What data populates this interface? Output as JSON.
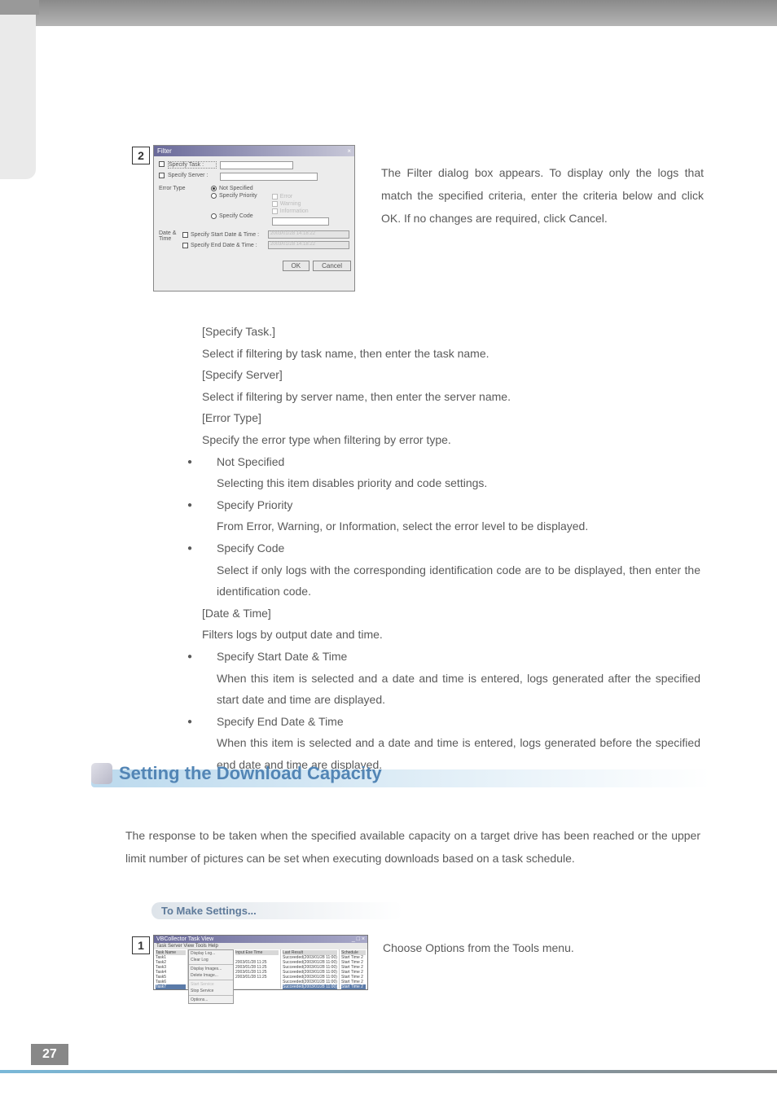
{
  "step2": {
    "num": "2"
  },
  "step1": {
    "num": "1"
  },
  "dialog": {
    "title": "Filter",
    "close": "×",
    "specifyTask": "Specify Task :",
    "specifyServer": "Specify Server :",
    "errorType": "Error Type",
    "notSpecified": "Not Specified",
    "specifyPriority": "Specify Priority",
    "specifyCode": "Specify Code",
    "cbError": "Error",
    "cbWarning": "Warning",
    "cbInfo": "Information",
    "dateTime": "Date & Time",
    "startDT": "Specify Start Date & Time :",
    "endDT": "Specify End Date & Time :",
    "dtValue": "2003/01/28 14:18:22",
    "ok": "OK",
    "cancel": "Cancel"
  },
  "rightDesc": "The Filter dialog box appears. To display only the logs that match the specified criteria, enter the criteria below and click OK. If no changes are required, click Cancel.",
  "spec": {
    "h1": "[Specify Task.]",
    "p1": "Select if filtering by task name, then enter the task name.",
    "h2": "[Specify Server]",
    "p2": "Select if filtering by server name, then enter the server name.",
    "h3": "[Error Type]",
    "p3": "Specify the error type when filtering by error type.",
    "b1": "Not Specified",
    "b1d": "Selecting this item disables priority and code settings.",
    "b2": "Specify Priority",
    "b2d": "From Error, Warning, or Information, select the error level to be displayed.",
    "b3": "Specify Code",
    "b3d": "Select if only logs with the corresponding identification code are to be displayed, then enter the identification code.",
    "h4": "[Date & Time]",
    "p4": "Filters logs by output date and time.",
    "b4": "Specify Start Date & Time",
    "b4d": "When this item is selected and a date and time is entered, logs generated after the specified start date and time are displayed.",
    "b5": "Specify End Date & Time",
    "b5d": "When this item is selected and a date and time is entered, logs generated before the specified end date and time are displayed."
  },
  "section": {
    "title": "Setting the Download Capacity",
    "desc": "The response to be taken when the specified available capacity on a target drive has been reached or the upper limit number of pictures can be set when executing downloads based on a task schedule.",
    "sub": "To Make Settings..."
  },
  "taskView": {
    "title": "VBCollector Task View",
    "wbtns": "_ □ ×",
    "menu": "Task    Server    View    Tools    Help",
    "colTask": "Task Name",
    "colInput": "Input Exe Time",
    "colLast": "Last Result",
    "colSched": "Schedule",
    "dd1": "Display Log...",
    "dd2": "Clear Log",
    "dd3": "Display Images...",
    "dd4": "Delete Image...",
    "dd5": "Start Service",
    "dd6": "Stop Service",
    "dd7": "Options...",
    "row": "Task",
    "dt": "2003/01/28 11:25",
    "res": "Succeeded(2003/01/28 11:00)",
    "sch": "Start Time 2"
  },
  "step1Desc": "Choose Options from the Tools menu.",
  "pageNum": "27"
}
